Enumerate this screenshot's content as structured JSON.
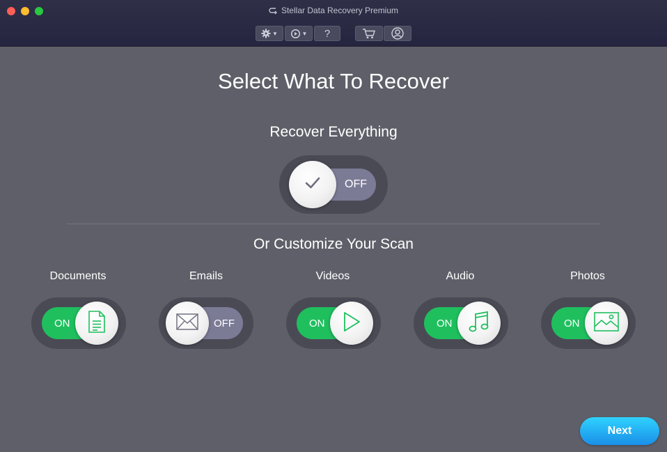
{
  "window": {
    "title": "Stellar Data Recovery Premium"
  },
  "toolbar": {
    "settings_icon": "gear-icon",
    "history_icon": "history-icon",
    "help_label": "?",
    "cart_icon": "cart-icon",
    "account_icon": "user-icon"
  },
  "main": {
    "heading": "Select What To Recover",
    "recover_everything": {
      "label": "Recover Everything",
      "state": "OFF"
    },
    "customize_heading": "Or Customize Your Scan",
    "categories": [
      {
        "label": "Documents",
        "state": "ON",
        "icon": "document-icon"
      },
      {
        "label": "Emails",
        "state": "OFF",
        "icon": "email-icon"
      },
      {
        "label": "Videos",
        "state": "ON",
        "icon": "play-icon"
      },
      {
        "label": "Audio",
        "state": "ON",
        "icon": "music-icon"
      },
      {
        "label": "Photos",
        "state": "ON",
        "icon": "photo-icon"
      }
    ]
  },
  "footer": {
    "next_label": "Next"
  },
  "colors": {
    "on": "#1fbf5e",
    "off": "#7c7b96",
    "background": "#5f5f69",
    "next": "#1a8fe8"
  }
}
